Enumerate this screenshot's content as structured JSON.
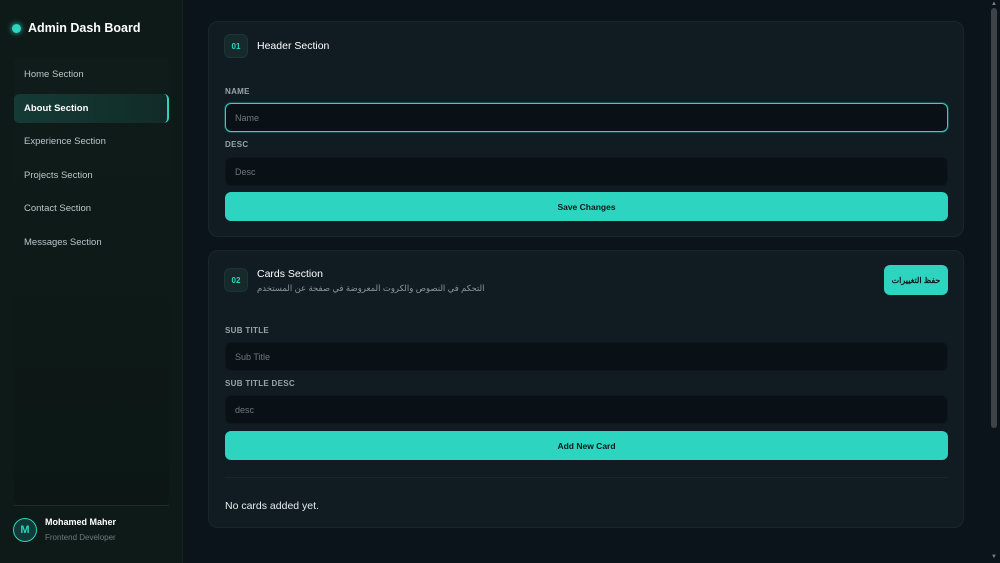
{
  "sidebar": {
    "brand_title": "Admin Dash Board",
    "items": [
      {
        "label": "Home Section"
      },
      {
        "label": "About Section"
      },
      {
        "label": "Experience Section"
      },
      {
        "label": "Projects Section"
      },
      {
        "label": "Contact Section"
      },
      {
        "label": "Messages Section"
      }
    ],
    "active_item": "About Section",
    "profile": {
      "initial": "M",
      "name": "Mohamed Maher",
      "role": "Frontend Developer"
    }
  },
  "header_section": {
    "number": "01",
    "title": "Header Section",
    "name_label": "NAME",
    "name_placeholder": "Name",
    "name_value": "",
    "desc_label": "DESC",
    "desc_placeholder": "Desc",
    "desc_value": "",
    "save_label": "Save Changes"
  },
  "cards_section": {
    "number": "02",
    "title": "Cards Section",
    "subtitle": "التحكم في النصوص والكروت المعروضة في صفحة عن المستخدم",
    "save_label": "حفظ التغييرات",
    "subtitle_label": "SUB TITLE",
    "subtitle_placeholder": "Sub Title",
    "subtitle_desc_label": "SUB TITLE DESC",
    "subtitle_desc_placeholder": "desc",
    "add_card_label": "Add New Card",
    "empty_text": "No cards added yet."
  },
  "colors": {
    "accent": "#2dd4bf",
    "background": "#0b141b",
    "card": "#111b22",
    "sidebar": "#0e1a17"
  },
  "icons": {
    "brand": "status-dot-icon",
    "scroll_up": "triangle-up-icon",
    "scroll_down": "triangle-down-icon"
  }
}
